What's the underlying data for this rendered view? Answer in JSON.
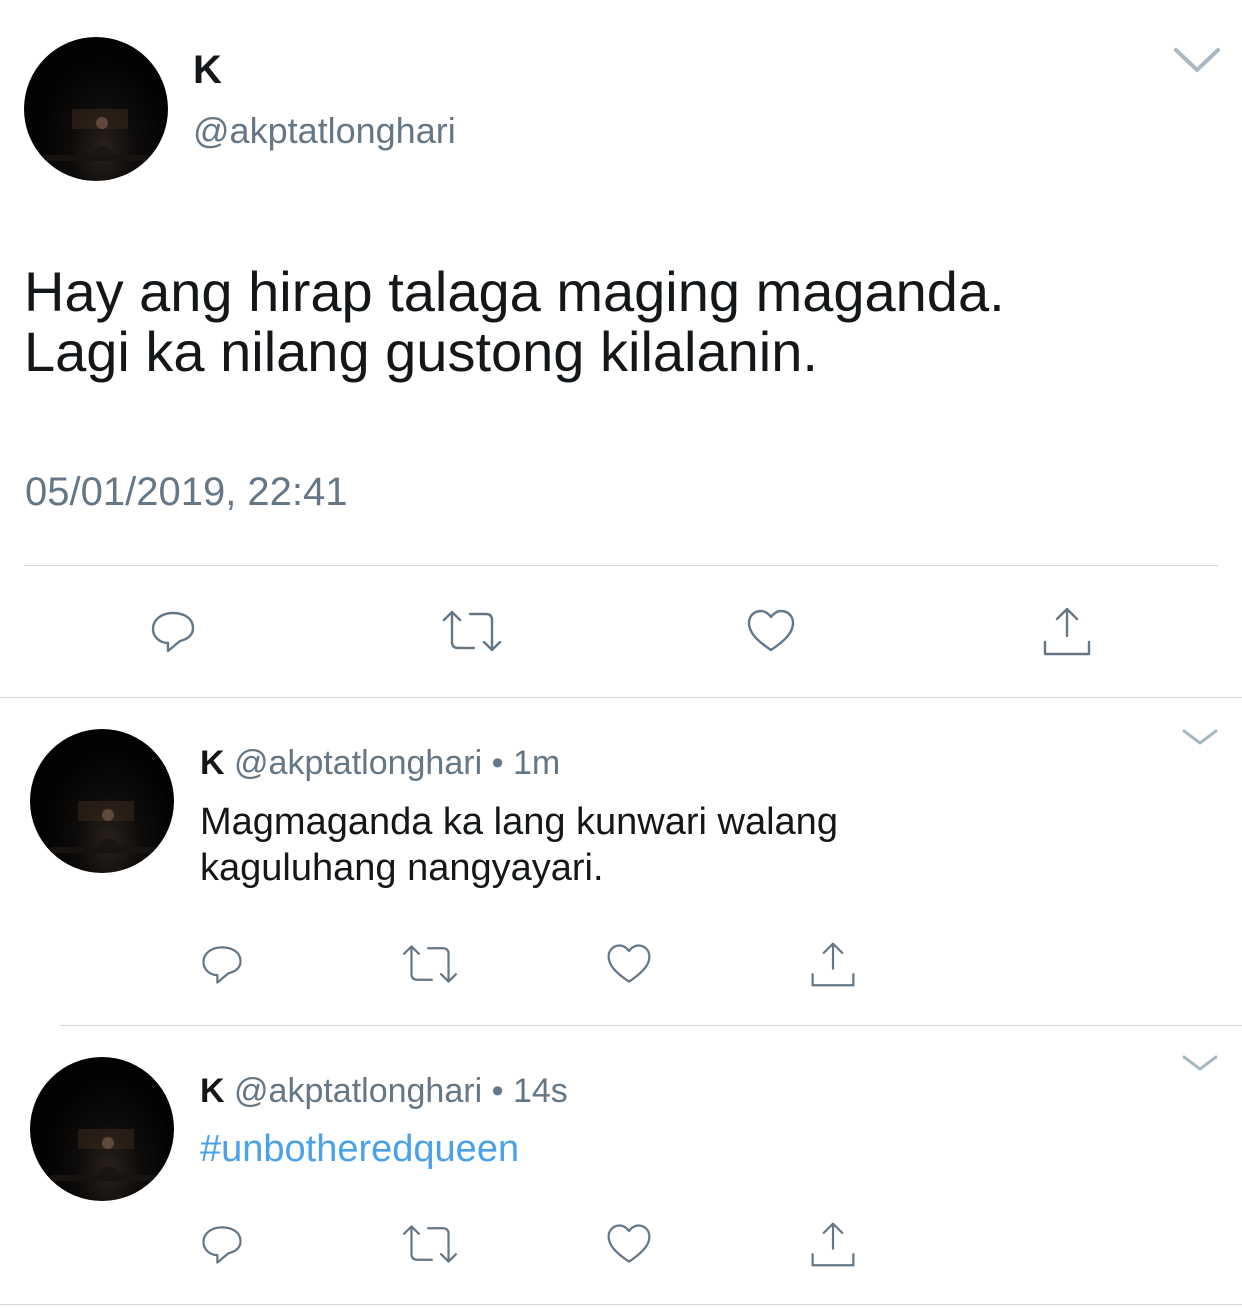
{
  "main_tweet": {
    "name": "K",
    "handle": "@akptatlonghari",
    "text_line1": "Hay ang hirap talaga maging maganda.",
    "text_line2": "Lagi ka nilang gustong kilalanin.",
    "timestamp": "05/01/2019, 22:41"
  },
  "replies": [
    {
      "name": "K",
      "handle": "@akptatlonghari",
      "separator": "•",
      "time": "1m",
      "text_line1": "Magmaganda ka lang kunwari walang",
      "text_line2": "kaguluhang nangyayari."
    },
    {
      "name": "K",
      "handle": "@akptatlonghari",
      "separator": "•",
      "time": "14s",
      "text_line1": "#unbotheredqueen"
    }
  ],
  "icons": {
    "menu": "chevron-down-icon",
    "reply": "reply-icon",
    "retweet": "retweet-icon",
    "like": "heart-icon",
    "share": "share-icon"
  },
  "colors": {
    "text": "#14171a",
    "secondary": "#657786",
    "link": "#4aa1eb",
    "divider": "#ccd6dd"
  }
}
